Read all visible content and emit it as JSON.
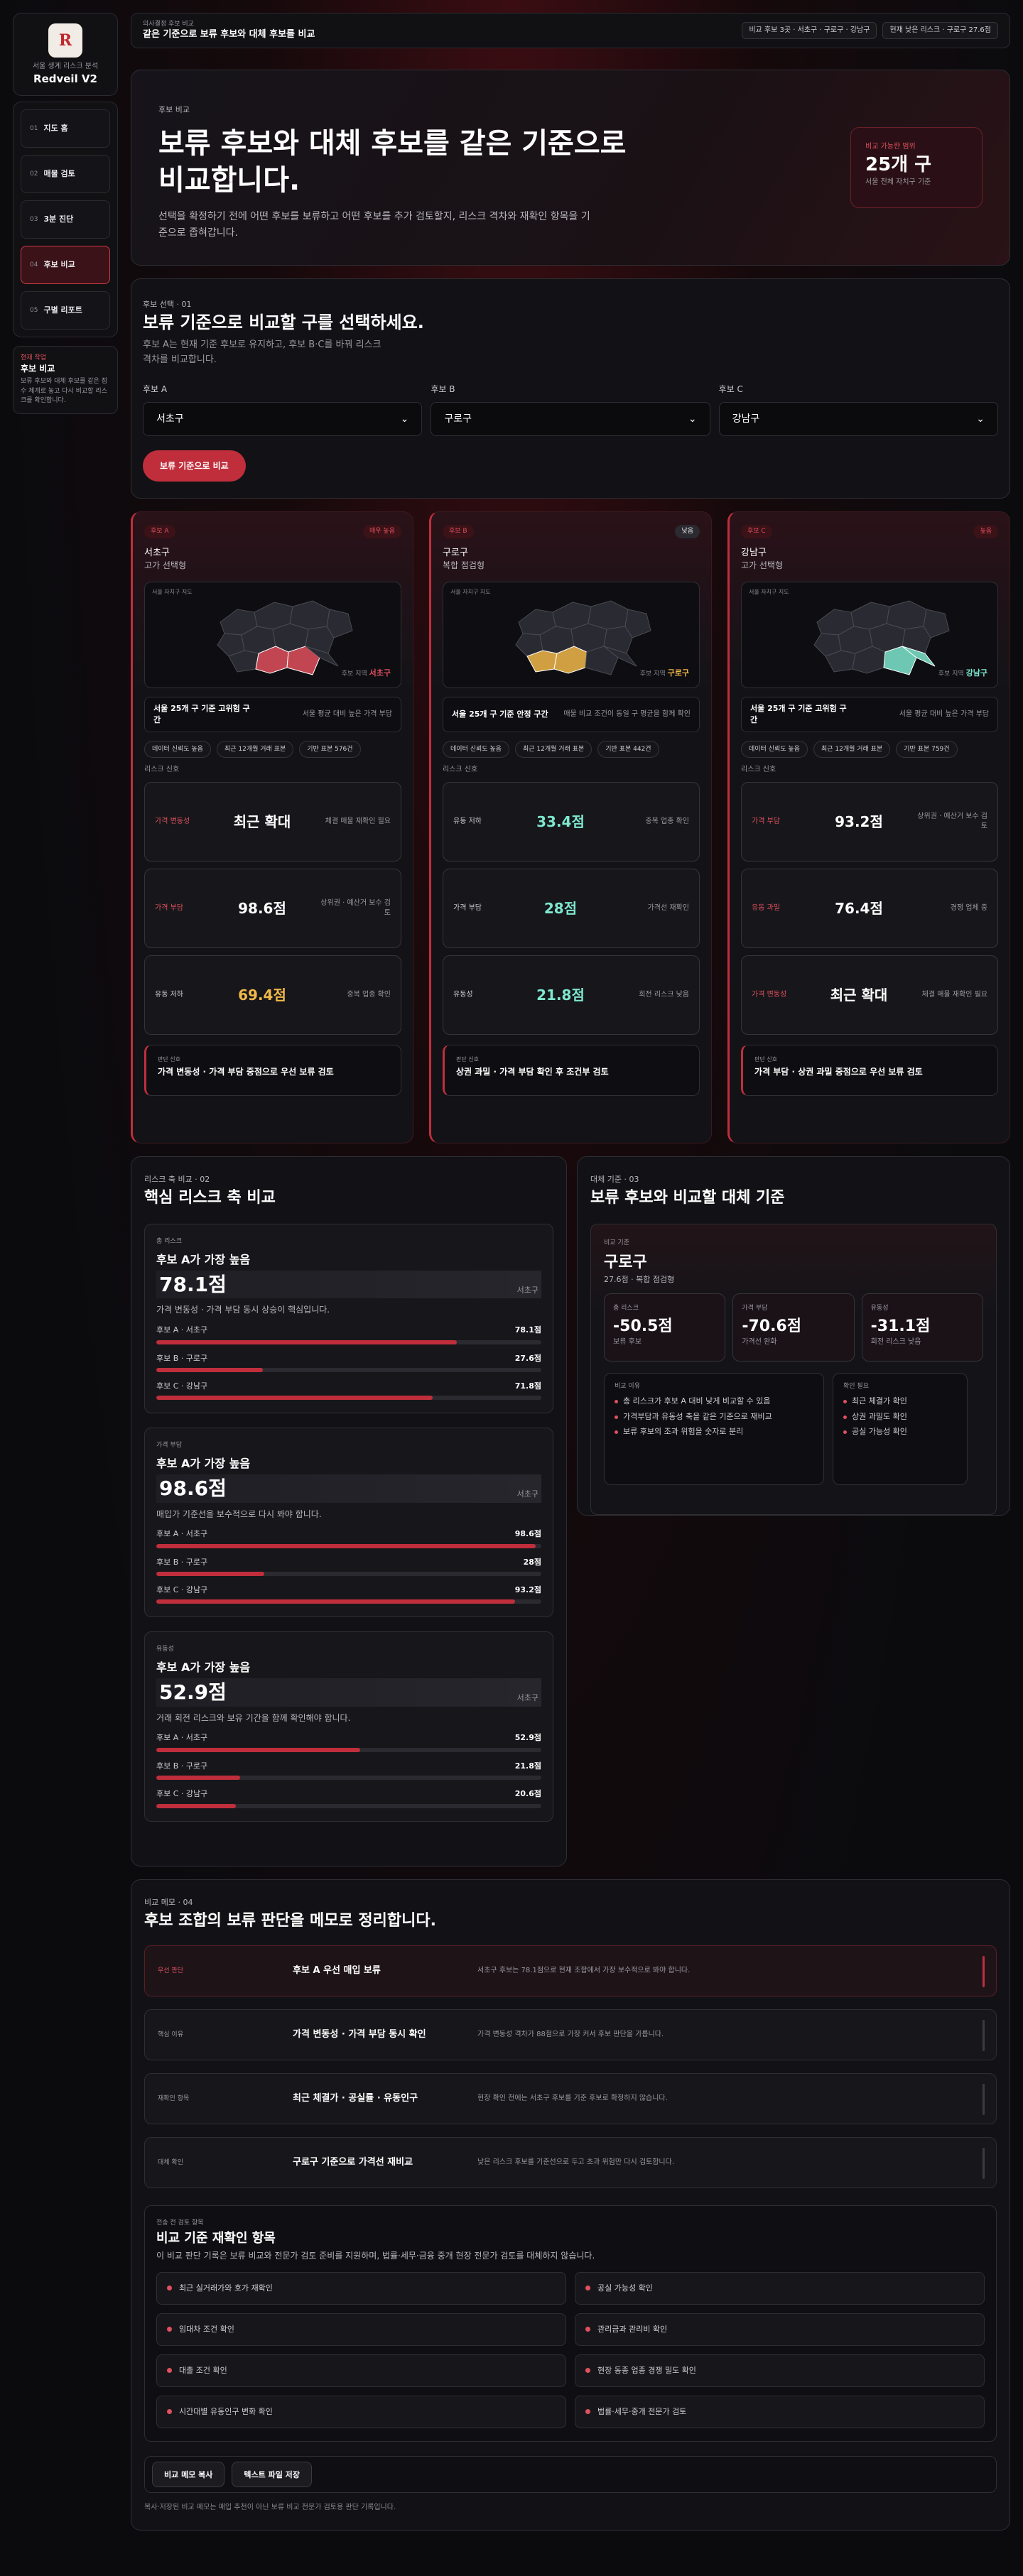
{
  "sidebar": {
    "logo": "R",
    "subtitle": "서울 생계 리스크 분석",
    "name": "Redveil V2",
    "items": [
      {
        "num": "01",
        "label": "지도 홈"
      },
      {
        "num": "02",
        "label": "매물 검토"
      },
      {
        "num": "03",
        "label": "3분 진단"
      },
      {
        "num": "04",
        "label": "후보 비교"
      },
      {
        "num": "05",
        "label": "구별 리포트"
      }
    ],
    "note": {
      "eyebrow": "현재 작업",
      "title": "후보 비교",
      "desc": "보류 후보와 대체 후보를 같은 점수 체계로 놓고 다시 비교할 리스크를 확인합니다."
    }
  },
  "topbar": {
    "eyebrow": "의사결정 후보 비교",
    "title": "같은 기준으로 보류 후보와 대체 후보를 비교",
    "chip1": "비교 후보 3곳 · 서초구 · 구로구 · 강남구",
    "chip2": "현재 낮은 리스크 · 구로구 27.6점"
  },
  "hero": {
    "eyebrow": "후보 비교",
    "title": "보류 후보와 대체 후보를 같은 기준으로 비교합니다.",
    "desc": "선택을 확정하기 전에 어떤 후보를 보류하고 어떤 후보를 추가 검토할지, 리스크 격차와 재확인 항목을 기준으로 좁혀갑니다.",
    "card": {
      "label": "비교 가능한 범위",
      "value": "25개 구",
      "desc": "서울 전체 자치구 기준"
    }
  },
  "selector": {
    "eyebrow": "후보 선택 · 01",
    "title": "보류 기준으로 비교할 구를 선택하세요.",
    "desc": "후보 A는 현재 기준 후보로 유지하고, 후보 B·C를 바꿔 리스크 격차를 비교합니다.",
    "fields": [
      {
        "label": "후보 A",
        "value": "서초구"
      },
      {
        "label": "후보 B",
        "value": "구로구"
      },
      {
        "label": "후보 C",
        "value": "강남구"
      }
    ],
    "button": "보류 기준으로 비교"
  },
  "candidates": [
    {
      "tag": "후보 A",
      "level": "매우 높음",
      "district": "서초구",
      "type": "고가 선택형",
      "map_label": "서울 자치구 지도",
      "legend_prefix": "후보 지역",
      "legend_name": "서초구",
      "color": "#e0505e",
      "rank_title": "서울 25개 구 기준 고위험 구간",
      "rank_desc": "서울 평균 대비 높은 가격 부담",
      "pills": [
        "데이터 신뢰도 높음",
        "최근 12개월 거래 표본",
        "기반 표본 576건"
      ],
      "signal_label": "리스크 신호",
      "signals": [
        {
          "name": "가격 변동성",
          "value": "최근 확대",
          "note": "체결 매물 재확인 필요",
          "red": true,
          "style": ""
        },
        {
          "name": "가격 부담",
          "value": "98.6점",
          "note": "상위권 · 예산거 보수 검토",
          "red": true,
          "style": ""
        },
        {
          "name": "유동 저하",
          "value": "69.4점",
          "note": "중복 업종 확인",
          "red": false,
          "style": "amb"
        }
      ],
      "judge_label": "판단 신호",
      "judge": "가격 변동성 · 가격 부담 중점으로 우선 보류 검토"
    },
    {
      "tag": "후보 B",
      "level": "낮음",
      "district": "구로구",
      "type": "복합 점검형",
      "map_label": "서울 자치구 지도",
      "legend_prefix": "후보 지역",
      "legend_name": "구로구",
      "color": "#f2b84a",
      "rank_title": "서울 25개 구 기준 안정 구간",
      "rank_desc": "매물 비교 조건이 동일 구 평균을 함께 확인",
      "pills": [
        "데이터 신뢰도 높음",
        "최근 12개월 거래 표본",
        "기반 표본 442건"
      ],
      "signal_label": "리스크 신호",
      "signals": [
        {
          "name": "유동 저하",
          "value": "33.4점",
          "note": "중복 업종 확인",
          "red": false,
          "style": "teal"
        },
        {
          "name": "가격 부담",
          "value": "28점",
          "note": "가격선 재확인",
          "red": false,
          "style": "teal"
        },
        {
          "name": "유동성",
          "value": "21.8점",
          "note": "회전 리스크 낮음",
          "red": false,
          "style": "teal"
        }
      ],
      "judge_label": "판단 신호",
      "judge": "상권 과밀 · 가격 부담 확인 후 조건부 검토"
    },
    {
      "tag": "후보 C",
      "level": "높음",
      "district": "강남구",
      "type": "고가 선택형",
      "map_label": "서울 자치구 지도",
      "legend_prefix": "후보 지역",
      "legend_name": "강남구",
      "color": "#7ee8cf",
      "rank_title": "서울 25개 구 기준 고위험 구간",
      "rank_desc": "서울 평균 대비 높은 가격 부담",
      "pills": [
        "데이터 신뢰도 높음",
        "최근 12개월 거래 표본",
        "기반 표본 759건"
      ],
      "signal_label": "리스크 신호",
      "signals": [
        {
          "name": "가격 부담",
          "value": "93.2점",
          "note": "상위권 · 예산거 보수 검토",
          "red": true,
          "style": ""
        },
        {
          "name": "유동 과밀",
          "value": "76.4점",
          "note": "경쟁 업체 중",
          "red": true,
          "style": ""
        },
        {
          "name": "가격 변동성",
          "value": "최근 확대",
          "note": "체결 매물 재확인 필요",
          "red": true,
          "style": ""
        }
      ],
      "judge_label": "판단 신호",
      "judge": "가격 부담 · 상권 과밀 중점으로 우선 보류 검토"
    }
  ],
  "axes": {
    "eyebrow": "리스크 축 비교 · 02",
    "title": "핵심 리스크 축 비교",
    "items": [
      {
        "label": "총 리스크",
        "headline": "후보 A가 가장 높음",
        "value": "78.1점",
        "district": "서초구",
        "desc": "가격 변동성 · 가격 부담 동시 상승이 핵심입니다.",
        "rows": [
          {
            "name": "후보 A · 서초구",
            "val": "78.1점",
            "pct": 0.781
          },
          {
            "name": "후보 B · 구로구",
            "val": "27.6점",
            "pct": 0.276
          },
          {
            "name": "후보 C · 강남구",
            "val": "71.8점",
            "pct": 0.718
          }
        ]
      },
      {
        "label": "가격 부담",
        "headline": "후보 A가 가장 높음",
        "value": "98.6점",
        "district": "서초구",
        "desc": "매입가 기준선을 보수적으로 다시 봐야 합니다.",
        "rows": [
          {
            "name": "후보 A · 서초구",
            "val": "98.6점",
            "pct": 0.986
          },
          {
            "name": "후보 B · 구로구",
            "val": "28점",
            "pct": 0.28
          },
          {
            "name": "후보 C · 강남구",
            "val": "93.2점",
            "pct": 0.932
          }
        ]
      },
      {
        "label": "유동성",
        "headline": "후보 A가 가장 높음",
        "value": "52.9점",
        "district": "서초구",
        "desc": "거래 회전 리스크와 보유 기간을 함께 확인해야 합니다.",
        "rows": [
          {
            "name": "후보 A · 서초구",
            "val": "52.9점",
            "pct": 0.529
          },
          {
            "name": "후보 B · 구로구",
            "val": "21.8점",
            "pct": 0.218
          },
          {
            "name": "후보 C · 강남구",
            "val": "20.6점",
            "pct": 0.206
          }
        ]
      }
    ]
  },
  "alt": {
    "eyebrow": "대체 기준 · 03",
    "title": "보류 후보와 비교할 대체 기준",
    "card_label": "비교 기준",
    "district": "구로구",
    "type": "27.6점 · 복합 점검형",
    "deltas": [
      {
        "label": "총 리스크",
        "value": "-50.5점",
        "desc": "보류 후보"
      },
      {
        "label": "가격 부담",
        "value": "-70.6점",
        "desc": "가격선 완화"
      },
      {
        "label": "유동성",
        "value": "-31.1점",
        "desc": "회전 리스크 낮음"
      }
    ],
    "reason_label": "비교 이유",
    "reasons": [
      "총 리스크가 후보 A 대비 낮게 비교할 수 있음",
      "가격부담과 유동성 축을 같은 기준으로 재비교",
      "보류 후보의 조과 위험을 숫자로 분리"
    ],
    "check_label": "확인 필요",
    "checks": [
      "최근 체결가 확인",
      "상권 과밀도 확인",
      "공실 가능성 확인"
    ]
  },
  "memo": {
    "eyebrow": "비교 메모 · 04",
    "title": "후보 조합의 보류 판단을 메모로 정리합니다.",
    "rows": [
      {
        "k": "우선 판단",
        "t": "후보 A 우선 매입 보류",
        "d": "서초구 후보는 78.1점으로 현재 조합에서 가장 보수적으로 봐야 합니다."
      },
      {
        "k": "핵심 이유",
        "t": "가격 변동성 · 가격 부담 동시 확인",
        "d": "가격 변동성 격차가 88점으로 가장 커서 후보 판단을 가릅니다."
      },
      {
        "k": "재확인 항목",
        "t": "최근 체결가 · 공실률 · 유동인구",
        "d": "현장 확인 전에는 서초구 후보를 기준 후보로 확정하지 않습니다."
      },
      {
        "k": "대체 확인",
        "t": "구로구 기준으로 가격선 재비교",
        "d": "낮은 리스크 후보를 기준선으로 두고 초과 위험만 다시 검토합니다."
      }
    ],
    "check": {
      "eyebrow": "전송 전 검토 항목",
      "title": "비교 기준 재확인 항목",
      "desc": "이 비교 판단 기록은 보류 비교와 전문가 검토 준비를 지원하며, 법률·세무·금융 중개 현장 전문가 검토를 대체하지 않습니다.",
      "items": [
        "최근 실거래가와 호가 재확인",
        "공실 가능성 확인",
        "임대차 조건 확인",
        "관리금과 관리비 확인",
        "대출 조건 확인",
        "현장 동종 업종 경쟁 밀도 확인",
        "시간대별 유동인구 변화 확인",
        "법률·세무·중개 전문가 검토"
      ]
    },
    "buttons": [
      "비교 메모 복사",
      "텍스트 파일 저장"
    ],
    "footer": "복사·저장된 비교 메모는 매입 추천이 아닌 보류 비교 전문가 검토용 판단 기록입니다."
  }
}
